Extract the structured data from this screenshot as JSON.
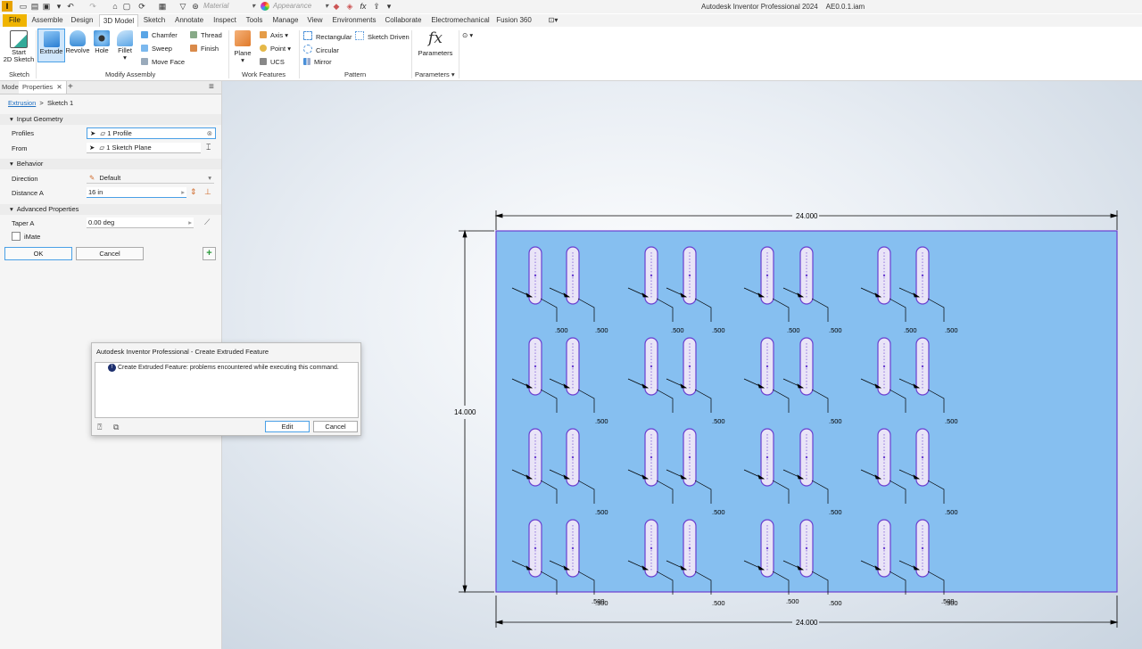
{
  "titlebar": {
    "logo": "I",
    "material_placeholder": "Material",
    "appearance_placeholder": "Appearance",
    "window_title": "Autodesk Inventor Professional 2024",
    "file_name": "AE0.0.1.iam"
  },
  "tabs": [
    "File",
    "Assemble",
    "Design",
    "3D Model",
    "Sketch",
    "Annotate",
    "Inspect",
    "Tools",
    "Manage",
    "View",
    "Environments",
    "Collaborate",
    "Electromechanical",
    "Fusion 360"
  ],
  "ribbon": {
    "start_sketch": [
      "Start",
      "2D Sketch"
    ],
    "extrude": "Extrude",
    "revolve": "Revolve",
    "hole": "Hole",
    "fillet": "Fillet",
    "chamfer": "Chamfer",
    "thread": "Thread",
    "sweep": "Sweep",
    "finish": "Finish",
    "move_face": "Move Face",
    "plane": "Plane",
    "axis": "Axis",
    "point": "Point",
    "ucs": "UCS",
    "rectangular": "Rectangular",
    "sketch_driven": "Sketch Driven",
    "circular": "Circular",
    "mirror": "Mirror",
    "parameters": "Parameters",
    "groups": {
      "sketch": "Sketch",
      "modify": "Modify Assembly",
      "work": "Work Features",
      "pattern": "Pattern",
      "parameters": "Parameters"
    }
  },
  "panel": {
    "tabs": [
      "Model",
      "Properties"
    ],
    "breadcrumb_link": "Extrusion",
    "breadcrumb_current": "Sketch 1",
    "sections": {
      "input": "Input Geometry",
      "behavior": "Behavior",
      "advanced": "Advanced Properties"
    },
    "profiles_label": "Profiles",
    "profiles_value": "1 Profile",
    "from_label": "From",
    "from_value": "1 Sketch Plane",
    "direction_label": "Direction",
    "direction_value": "Default",
    "distance_label": "Distance A",
    "distance_value": "16 in",
    "taper_label": "Taper A",
    "taper_value": "0.00 deg",
    "imate_label": "iMate",
    "ok": "OK",
    "cancel": "Cancel"
  },
  "dialog": {
    "title": "Autodesk Inventor Professional - Create Extruded Feature",
    "message": "Create Extruded Feature: problems encountered while executing this command.",
    "edit": "Edit",
    "cancel": "Cancel"
  },
  "drawing": {
    "width_dim": "24.000",
    "height_dim": "14.000",
    "slot_dim": ".500",
    "colors": {
      "plate": "#86bff0",
      "outline": "#6a3fd0",
      "slot_fill": "#e9e4f7"
    }
  }
}
